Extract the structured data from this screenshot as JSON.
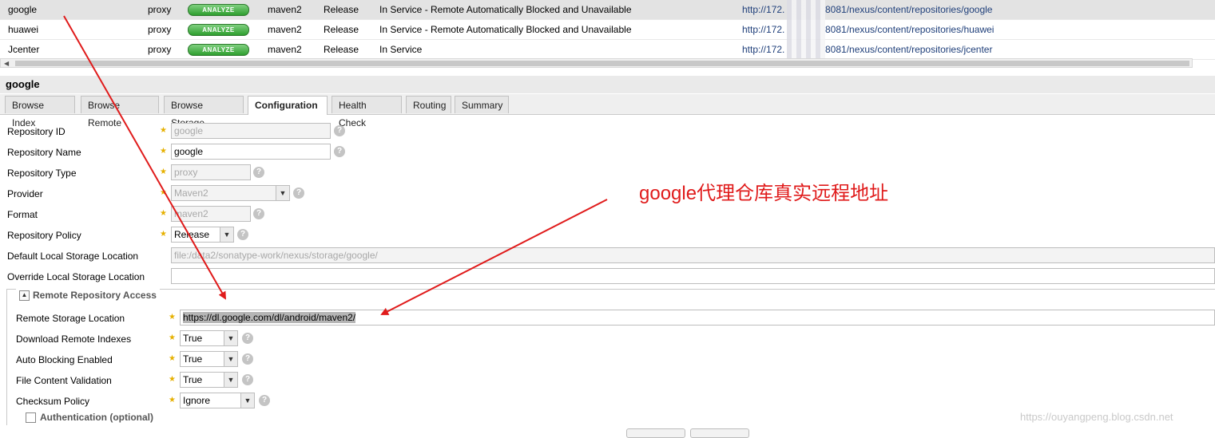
{
  "repo_rows": [
    {
      "name": "google",
      "type": "proxy",
      "analyze": "ANALYZE",
      "format": "maven2",
      "policy": "Release",
      "status": "In Service - Remote Automatically Blocked and Unavailable",
      "url_a": "http://172.",
      "url_b": "8081/nexus/content/repositories/google"
    },
    {
      "name": "huawei",
      "type": "proxy",
      "analyze": "ANALYZE",
      "format": "maven2",
      "policy": "Release",
      "status": "In Service - Remote Automatically Blocked and Unavailable",
      "url_a": "http://172.",
      "url_b": "8081/nexus/content/repositories/huawei"
    },
    {
      "name": "Jcenter",
      "type": "proxy",
      "analyze": "ANALYZE",
      "format": "maven2",
      "policy": "Release",
      "status": "In Service",
      "url_a": "http://172.",
      "url_b": "8081/nexus/content/repositories/jcenter"
    }
  ],
  "panel": {
    "title": "google"
  },
  "tabs": [
    "Browse Index",
    "Browse Remote",
    "Browse Storage",
    "Configuration",
    "Health Check",
    "Routing",
    "Summary"
  ],
  "active_tab": "Configuration",
  "form": {
    "repo_id": {
      "label": "Repository ID",
      "value": "google"
    },
    "repo_name": {
      "label": "Repository Name",
      "value": "google"
    },
    "repo_type": {
      "label": "Repository Type",
      "value": "proxy"
    },
    "provider": {
      "label": "Provider",
      "value": "Maven2"
    },
    "format": {
      "label": "Format",
      "value": "maven2"
    },
    "policy": {
      "label": "Repository Policy",
      "value": "Release"
    },
    "default_storage": {
      "label": "Default Local Storage Location",
      "value": "file:/data2/sonatype-work/nexus/storage/google/"
    },
    "override_storage": {
      "label": "Override Local Storage Location",
      "value": ""
    }
  },
  "remote": {
    "legend": "Remote Repository Access",
    "location": {
      "label": "Remote Storage Location",
      "value": "https://dl.google.com/dl/android/maven2/"
    },
    "download_indexes": {
      "label": "Download Remote Indexes",
      "value": "True"
    },
    "auto_blocking": {
      "label": "Auto Blocking Enabled",
      "value": "True"
    },
    "file_validation": {
      "label": "File Content Validation",
      "value": "True"
    },
    "checksum": {
      "label": "Checksum Policy",
      "value": "Ignore"
    }
  },
  "auth": {
    "legend": "Authentication (optional)"
  },
  "annotation": "google代理仓库真实远程地址",
  "watermark": "https://ouyangpeng.blog.csdn.net",
  "colors": {
    "annotation": "#e01b1b",
    "analyze": "#2f9e2f",
    "star": "#e6b000"
  }
}
